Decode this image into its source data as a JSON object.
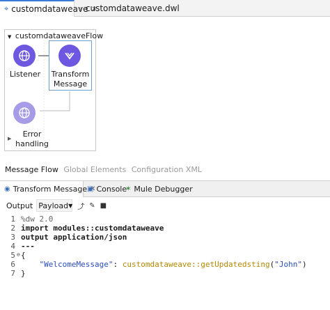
{
  "editor_tabs": [
    {
      "label": "customdataweave",
      "icon": "mule-flow-icon",
      "active": true
    },
    {
      "label": "customdataweave.dwl",
      "icon": "dataweave-file-icon",
      "active": false
    }
  ],
  "flow": {
    "name": "customdataweaveFlow",
    "source_label": "Listener",
    "processor_label_1": "Transform",
    "processor_label_2": "Message",
    "error_label_1": "Error",
    "error_label_2": "handling"
  },
  "message_flow_tabs": [
    "Message Flow",
    "Global Elements",
    "Configuration XML"
  ],
  "panel_tabs": [
    {
      "label": "Transform Message",
      "icon": "transform-icon",
      "active": true
    },
    {
      "label": "Console",
      "icon": "console-icon",
      "active": false
    },
    {
      "label": "Mule Debugger",
      "icon": "bug-icon",
      "active": false
    }
  ],
  "toolbar": {
    "output_label": "Output",
    "target": "Payload"
  },
  "code": {
    "line_numbers": [
      "1",
      "2",
      "3",
      "4",
      "5",
      "6",
      "7"
    ],
    "l1": "%dw 2.0",
    "l2_kw": "import",
    "l2_rest": " modules::customdataweave",
    "l3_kw": "output",
    "l3_rest": " application/json",
    "l4": "---",
    "l5": "{",
    "l6_key": "\"WelcomeMessage\"",
    "l6_colon": ": ",
    "l6_fn": "customdataweave::getUpdatedsting",
    "l6_open": "(",
    "l6_arg": "\"John\"",
    "l6_close": ")",
    "l7": "}"
  },
  "colors": {
    "accent": "#6e58e0",
    "selection_border": "#6a9fd8",
    "string": "#2b4dbb",
    "function": "#b38800"
  }
}
